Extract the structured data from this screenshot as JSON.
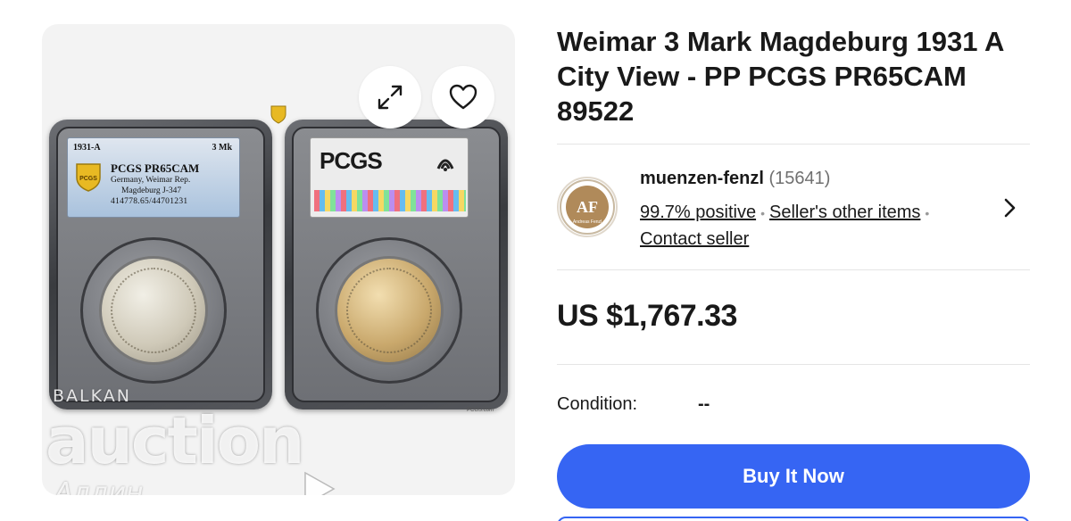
{
  "image_panel": {
    "expand_icon": "expand-icon",
    "heart_icon": "heart-icon",
    "slab_label": {
      "year": "1931-A",
      "denomination": "3 Mk",
      "grade": "PCGS PR65CAM",
      "line1": "Germany, Weimar Rep.",
      "line2": "Magdeburg J-347",
      "line3": "414778.65/44701231"
    },
    "back_logo": "PCGS",
    "url_text": "PCGS.com",
    "watermark": {
      "small": "BALKAN",
      "big": "auction",
      "sub": "Алдин"
    }
  },
  "listing": {
    "title": "Weimar 3 Mark Magdeburg 1931 A City View - PP PCGS PR65CAM 89522",
    "seller": {
      "name": "muenzen-fenzl",
      "feedback_count": "(15641)",
      "positive": "99.7% positive",
      "other_items": "Seller's other items",
      "contact": "Contact seller",
      "avatar_text": "Andreas Fenzl"
    },
    "price": "US $1,767.33",
    "condition_label": "Condition:",
    "condition_value": "--",
    "buy_button": "Buy It Now"
  },
  "colors": {
    "accent": "#3665f3",
    "text": "#191919",
    "muted": "#707070"
  }
}
